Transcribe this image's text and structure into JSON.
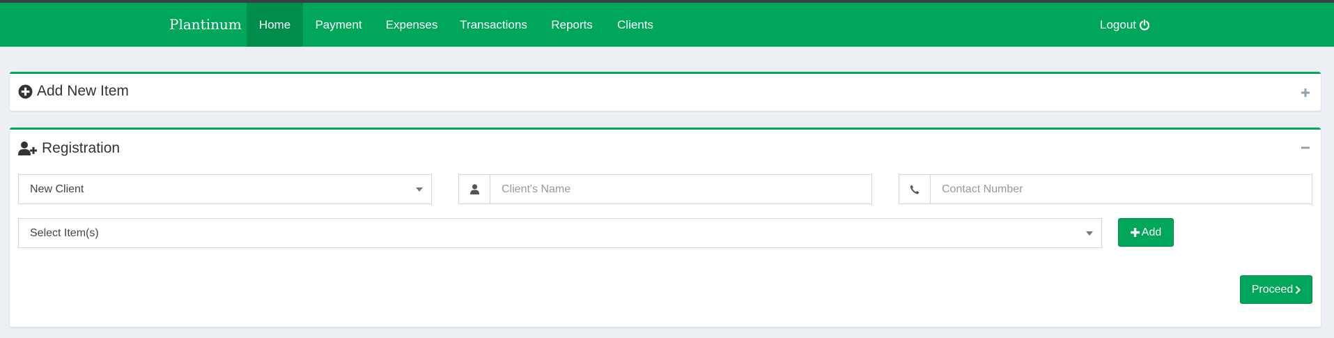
{
  "nav": {
    "brand": "Plantinum",
    "items": [
      {
        "label": "Home",
        "active": true
      },
      {
        "label": "Payment",
        "active": false
      },
      {
        "label": "Expenses",
        "active": false
      },
      {
        "label": "Transactions",
        "active": false
      },
      {
        "label": "Reports",
        "active": false
      },
      {
        "label": "Clients",
        "active": false
      }
    ],
    "logout_label": "Logout",
    "logout_icon": "power-icon"
  },
  "colors": {
    "accent": "#00a65a",
    "accent_dark": "#008d4c",
    "background": "#ecf0f5"
  },
  "add_item_box": {
    "title": "Add New Item",
    "icon": "plus-circle-icon",
    "tool_icon": "plus-icon",
    "collapsed": true
  },
  "registration_box": {
    "title": "Registration",
    "icon": "user-plus-icon",
    "tool_icon": "minus-icon",
    "client_type": {
      "selected": "New Client"
    },
    "client_name": {
      "value": "",
      "placeholder": "Client's Name",
      "icon": "user-icon"
    },
    "contact_number": {
      "value": "",
      "placeholder": "Contact Number",
      "icon": "phone-icon"
    },
    "items_select": {
      "selected": "Select Item(s)"
    },
    "add_button": {
      "label": "Add",
      "icon": "plus-icon"
    },
    "proceed_button": {
      "label": "Proceed",
      "icon": "chevron-right-icon"
    }
  }
}
